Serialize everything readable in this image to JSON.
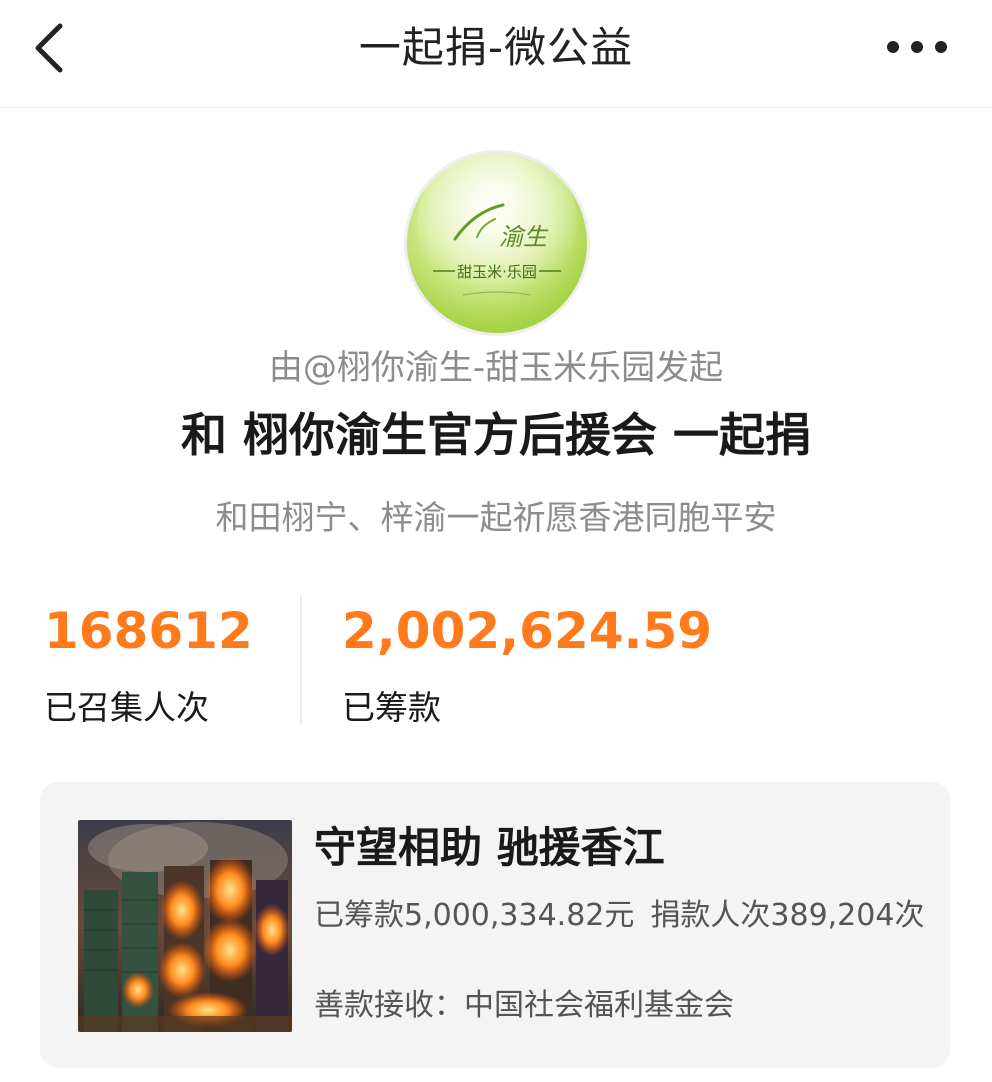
{
  "header": {
    "title": "一起捐-微公益",
    "back_icon": "chevron-left-icon",
    "more_icon": "more-dots-icon"
  },
  "campaign": {
    "initiator": "由@栩你渝生-甜玉米乐园发起",
    "title": "和 栩你渝生官方后援会 一起捐",
    "subtitle": "和田栩宁、梓渝一起祈愿香港同胞平安"
  },
  "stats": {
    "participants_value": "168612",
    "participants_label": "已召集人次",
    "raised_value": "2,002,624.59",
    "raised_label": "已筹款"
  },
  "project": {
    "title": "守望相助 驰援香江",
    "raised_text": "已筹款5,000,334.82元",
    "donors_text": "捐款人次389,204次",
    "receiver_text": "善款接收：中国社会福利基金会"
  },
  "colors": {
    "accent": "#ff7a1a",
    "muted_text": "#8c8c8c",
    "card_bg": "#f4f4f4"
  }
}
